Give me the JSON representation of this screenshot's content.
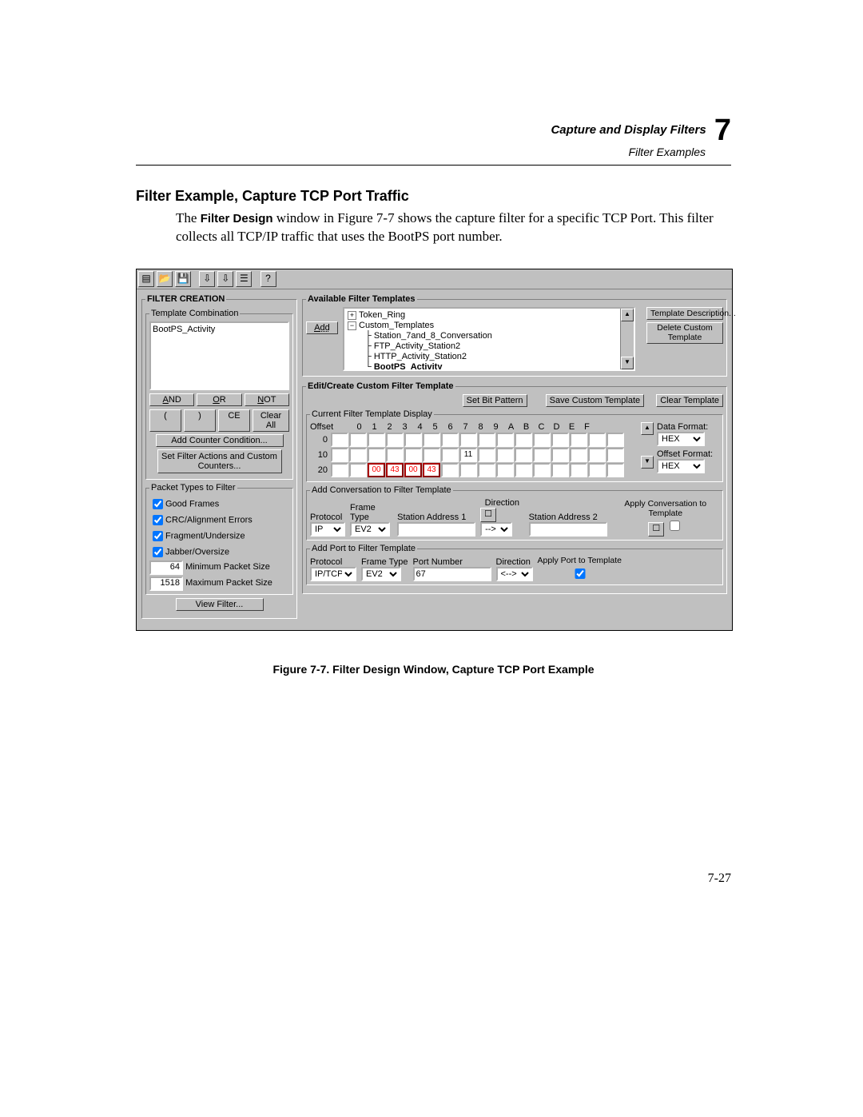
{
  "header": {
    "line1": "Capture and Display Filters",
    "line2": "Filter Examples",
    "chapter": "7"
  },
  "section_title": "Filter Example, Capture TCP Port Traffic",
  "paragraph_pre": "The ",
  "paragraph_bold": "Filter Design",
  "paragraph_post": " window in Figure 7-7 shows the capture filter for a specific TCP Port. This filter collects all TCP/IP traffic that uses the BootPS port number.",
  "caption": "Figure 7-7.  Filter Design Window, Capture TCP Port Example",
  "page_number": "7-27",
  "toolbar": {
    "icons": [
      "📄",
      "📂",
      "💾",
      "",
      "🔽",
      "🔽",
      "📋",
      "",
      "❓"
    ]
  },
  "filter_creation": {
    "title": "FILTER CREATION",
    "template_combo_label": "Template Combination",
    "combo_value": "BootPS_Activity",
    "btn_and": "AND",
    "btn_or": "OR",
    "btn_not": "NOT",
    "btn_lp": "(",
    "btn_rp": ")",
    "btn_ce": "CE",
    "btn_clearall": "Clear All",
    "btn_addcounter": "Add Counter Condition...",
    "btn_setfilter": "Set Filter Actions and Custom Counters...",
    "pkt_title": "Packet Types to Filter",
    "chk_good": "Good Frames",
    "chk_crc": "CRC/Alignment Errors",
    "chk_frag": "Fragment/Undersize",
    "chk_jab": "Jabber/Oversize",
    "min_val": "64",
    "min_lbl": "Minimum Packet Size",
    "max_val": "1518",
    "max_lbl": "Maximum Packet Size",
    "btn_view": "View Filter..."
  },
  "available": {
    "title": "Available Filter Templates",
    "btn_add": "Add",
    "tree": {
      "n1": "Token_Ring",
      "n2": "Custom_Templates",
      "c1": "Station_7and_8_Conversation",
      "c2": "FTP_Activity_Station2",
      "c3": "HTTP_Activity_Station2",
      "c4": "BootPS_Activity"
    },
    "btn_desc": "Template Description...",
    "btn_del": "Delete Custom Template"
  },
  "edit": {
    "title": "Edit/Create Custom Filter Template",
    "btn_setbit": "Set Bit Pattern",
    "btn_save": "Save Custom Template",
    "btn_clear": "Clear Template",
    "cur_label": "Current Filter Template Display",
    "offset_label": "Offset",
    "hex_cols": [
      "0",
      "1",
      "2",
      "3",
      "4",
      "5",
      "6",
      "7",
      "8",
      "9",
      "A",
      "B",
      "C",
      "D",
      "E",
      "F"
    ],
    "data_format": "Data Format:",
    "offset_format": "Offset Format:",
    "hex_sel": "HEX",
    "rows": {
      "r0": "0",
      "r10": "10",
      "r20": "20"
    },
    "r10_v7": "11",
    "r20_v2": "00",
    "r20_v3": "43",
    "r20_v4": "00",
    "r20_v5": "43"
  },
  "addconv": {
    "title": "Add Conversation to Filter Template",
    "protocol": "Protocol",
    "frametype": "Frame Type",
    "sa1": "Station Address 1",
    "dir": "Direction",
    "sa2": "Station Address 2",
    "apply": "Apply Conversation to Template",
    "proto_v": "IP",
    "ft_v": "EV2",
    "dir_v": "-->"
  },
  "addport": {
    "title": "Add Port to Filter Template",
    "protocol": "Protocol",
    "frametype": "Frame Type",
    "portnum": "Port Number",
    "dir": "Direction",
    "apply": "Apply Port to Template",
    "proto_v": "IP/TCP",
    "ft_v": "EV2",
    "port_v": "67",
    "dir_v": "<-->"
  }
}
